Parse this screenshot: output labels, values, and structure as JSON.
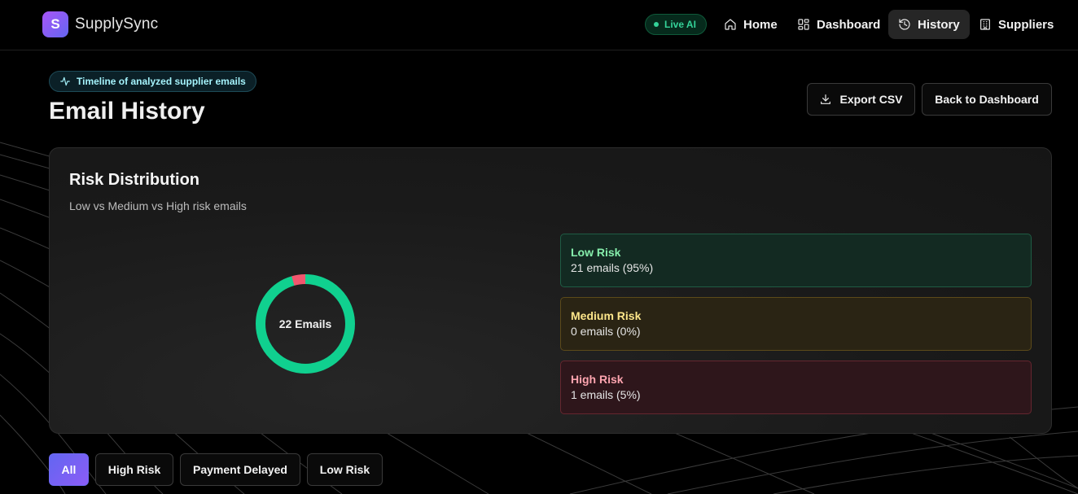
{
  "app": {
    "logo_letter": "S",
    "name": "SupplySync"
  },
  "nav": {
    "live_label": "Live AI",
    "items": [
      {
        "label": "Home",
        "icon": "home-icon"
      },
      {
        "label": "Dashboard",
        "icon": "dashboard-icon"
      },
      {
        "label": "History",
        "icon": "history-icon",
        "active": true
      },
      {
        "label": "Suppliers",
        "icon": "building-icon"
      }
    ]
  },
  "header": {
    "badge": "Timeline of analyzed supplier emails",
    "title": "Email History",
    "export_label": "Export CSV",
    "back_label": "Back to Dashboard"
  },
  "risk": {
    "title": "Risk Distribution",
    "subtitle": "Low vs Medium vs High risk emails",
    "donut_label": "22 Emails",
    "items": [
      {
        "name": "Low Risk",
        "count": "21 emails (95%)"
      },
      {
        "name": "Medium Risk",
        "count": "0 emails (0%)"
      },
      {
        "name": "High Risk",
        "count": "1 emails (5%)"
      }
    ]
  },
  "chart_data": {
    "type": "pie",
    "categories": [
      "Low Risk",
      "Medium Risk",
      "High Risk"
    ],
    "values": [
      21,
      0,
      1
    ],
    "colors": [
      "#10d08f",
      "#f5c542",
      "#f1566e"
    ]
  },
  "filters": [
    {
      "label": "All",
      "active": true
    },
    {
      "label": "High Risk"
    },
    {
      "label": "Payment Delayed"
    },
    {
      "label": "Low Risk"
    }
  ]
}
